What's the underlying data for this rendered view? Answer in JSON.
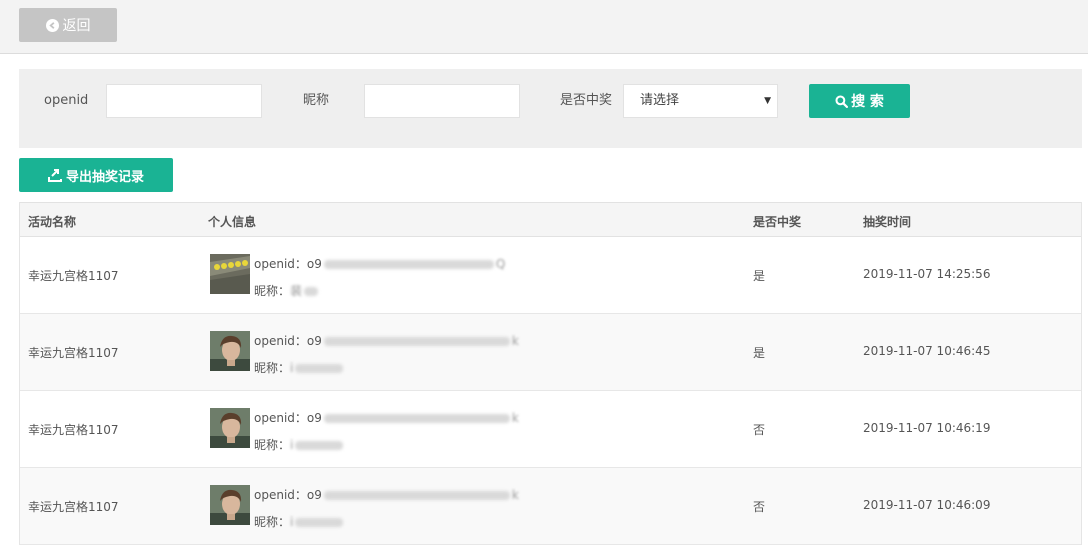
{
  "toolbar": {
    "back_label": "返回"
  },
  "filter": {
    "openid_label": "openid",
    "nickname_label": "昵称",
    "win_label": "是否中奖",
    "win_select_value": "请选择",
    "search_label": "搜 索"
  },
  "export_label": "导出抽奖记录",
  "table": {
    "headers": [
      "活动名称",
      "个人信息",
      "是否中奖",
      "抽奖时间"
    ],
    "openid_prefix": "openid：",
    "nickname_prefix": "昵称：",
    "rows": [
      {
        "activity": "幸运九宫格1107",
        "openid_start": "o9",
        "openid_end": "Q",
        "nickname_start": "裴",
        "won": "是",
        "time": "2019-11-07 14:25:56"
      },
      {
        "activity": "幸运九宫格1107",
        "openid_start": "o9",
        "openid_end": "k",
        "nickname_start": "i",
        "won": "是",
        "time": "2019-11-07 10:46:45"
      },
      {
        "activity": "幸运九宫格1107",
        "openid_start": "o9",
        "openid_end": "k",
        "nickname_start": "i",
        "won": "否",
        "time": "2019-11-07 10:46:19"
      },
      {
        "activity": "幸运九宫格1107",
        "openid_start": "o9",
        "openid_end": "k",
        "nickname_start": "i",
        "won": "否",
        "time": "2019-11-07 10:46:09"
      }
    ]
  },
  "icons": {
    "back": "arrow-left-circle-icon",
    "search": "search-icon",
    "export": "export-icon",
    "caret": "caret-down-icon"
  },
  "colors": {
    "primary": "#1ab394",
    "back_button": "#c5c5c5"
  }
}
